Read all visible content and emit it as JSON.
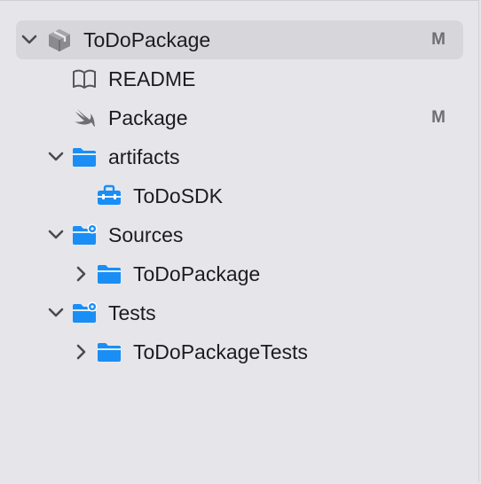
{
  "tree": {
    "root": {
      "label": "ToDoPackage",
      "badge": "M",
      "icon": "package-icon"
    },
    "readme": {
      "label": "README",
      "icon": "book-icon"
    },
    "package": {
      "label": "Package",
      "badge": "M",
      "icon": "swift-icon"
    },
    "artifacts": {
      "label": "artifacts",
      "icon": "folder-icon"
    },
    "todosdk": {
      "label": "ToDoSDK",
      "icon": "toolbox-icon"
    },
    "sources": {
      "label": "Sources",
      "icon": "folder-gear-icon"
    },
    "sources_todopackage": {
      "label": "ToDoPackage",
      "icon": "folder-icon"
    },
    "tests": {
      "label": "Tests",
      "icon": "folder-gear-icon"
    },
    "tests_todopackagetests": {
      "label": "ToDoPackageTests",
      "icon": "folder-icon"
    }
  },
  "colors": {
    "accent": "#1a8ef5",
    "selection": "#d6d6db",
    "background": "#e6e6ea",
    "text": "#1c1c1e",
    "badge": "#6e6e73"
  }
}
